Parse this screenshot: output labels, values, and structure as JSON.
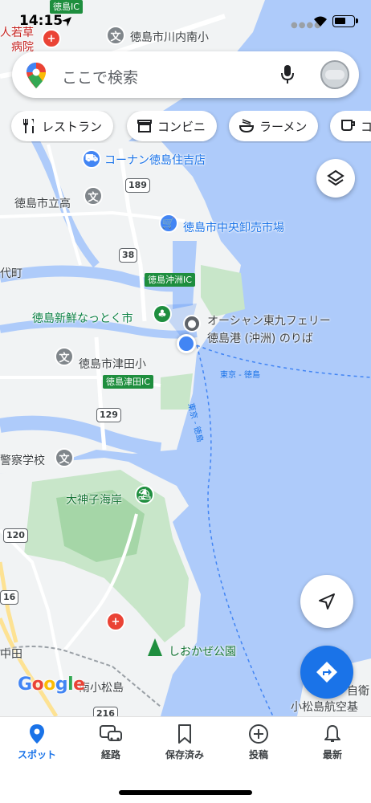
{
  "status_bar": {
    "time": "14:15"
  },
  "search": {
    "placeholder": "ここで検索"
  },
  "chips": [
    {
      "label": "レストラン",
      "icon": "restaurant-icon"
    },
    {
      "label": "コンビニ",
      "icon": "convenience-store-icon"
    },
    {
      "label": "ラーメン",
      "icon": "ramen-icon"
    },
    {
      "label": "コ",
      "icon": "cafe-icon"
    }
  ],
  "map": {
    "labels": {
      "top_ic": "徳島IC",
      "top_left_1": "人若草",
      "top_left_2": "病院",
      "kawauchi_school": "徳島市川内南小",
      "konan": "コーナン徳島住吉店",
      "high_school": "徳島市立高",
      "market": "徳島市中央卸売市場",
      "route_189": "189",
      "route_38": "38",
      "okinosu_ic": "徳島沖洲IC",
      "left_town": "代町",
      "fresh_market": "徳島新鮮なっとく市",
      "ferry_1": "オーシャン東九フェリー",
      "ferry_2": "徳島港 (沖洲) のりば",
      "tsuda_school": "徳島市津田小",
      "tsuda_ic": "徳島津田IC",
      "route_129": "129",
      "police_school": "警察学校",
      "okami_beach": "大神子海岸",
      "route_120": "120",
      "route_16": "16",
      "shiokaze_park": "しおかぜ公園",
      "nakata": "中田",
      "minami_komatsushima": "南小松島",
      "route_216": "216",
      "komatsushima_base": "小松島航空基",
      "right_edge": "自衛",
      "ferry_route_1": "東京 - 徳島",
      "ferry_route_2": "東京 - 徳島"
    },
    "google_logo": "Google"
  },
  "bottom_nav": [
    {
      "label": "スポット",
      "icon": "location-pin-icon",
      "active": true
    },
    {
      "label": "経路",
      "icon": "commute-icon",
      "active": false
    },
    {
      "label": "保存済み",
      "icon": "bookmark-icon",
      "active": false
    },
    {
      "label": "投稿",
      "icon": "add-circle-icon",
      "active": false
    },
    {
      "label": "最新",
      "icon": "bell-icon",
      "active": false
    }
  ],
  "colors": {
    "water": "#aecbfa",
    "land": "#f1f3f4",
    "park": "#c8e6c9",
    "accent": "#1a73e8"
  }
}
